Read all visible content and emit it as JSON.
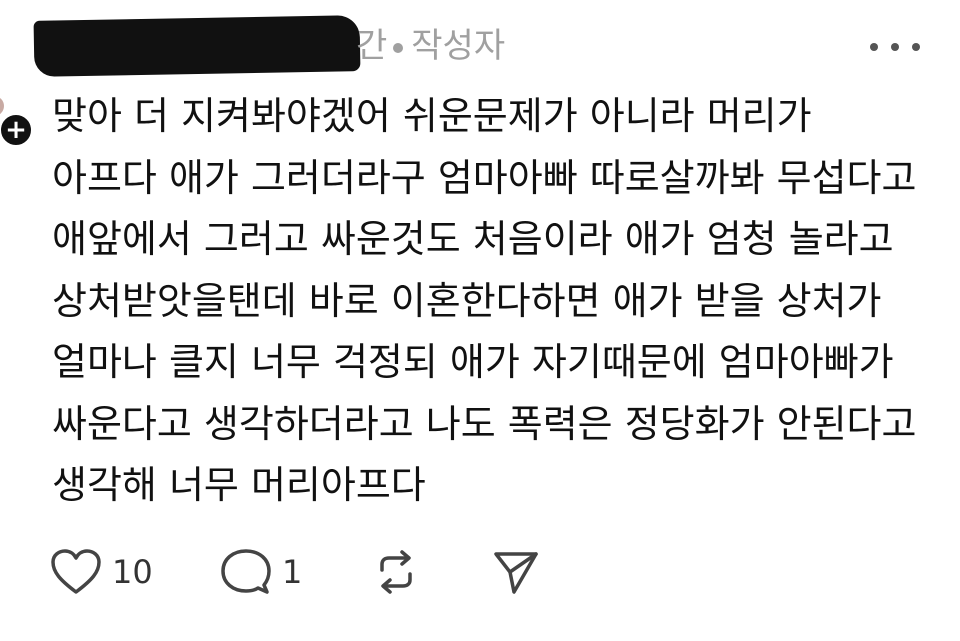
{
  "post": {
    "meta": {
      "time_fragment": "간",
      "author_badge": "작성자"
    },
    "body_lines": [
      "맞아 더 지켜봐야겠어 쉬운문제가 아니라 머리가",
      "아프다 애가 그러더라구 엄마아빠 따로살까봐 무섭다고",
      "애앞에서 그러고 싸운것도 처음이라 애가 엄청 놀라고",
      "상처받앗을탠데 바로 이혼한다하면 애가 받을 상처가",
      "얼마나 클지 너무 걱정되 애가 자기때문에 엄마아빠가",
      "싸운다고 생각하더라고 나도 폭력은 정당화가 안된다고",
      "생각해 너무 머리아프다"
    ],
    "actions": {
      "like_icon": "heart-icon",
      "like_count": "10",
      "reply_icon": "comment-icon",
      "reply_count": "1",
      "repost_icon": "repost-icon",
      "share_icon": "send-icon"
    }
  },
  "colors": {
    "text": "#111111",
    "meta": "#a0a0a0",
    "icon": "#444444"
  }
}
